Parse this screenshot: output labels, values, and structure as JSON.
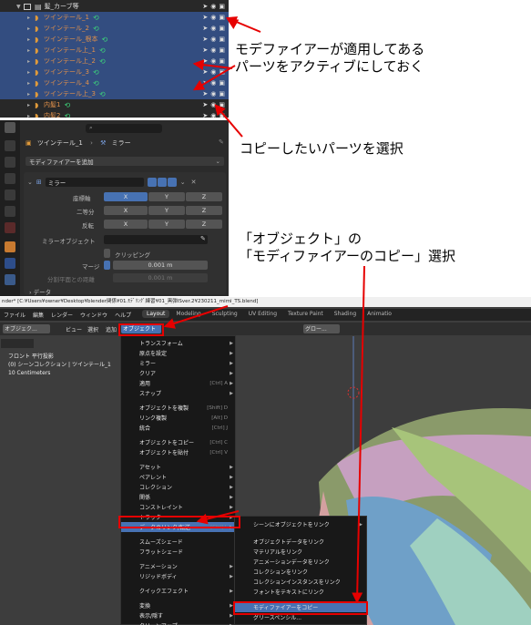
{
  "annotations": {
    "a1_line1": "モデファイアーが適用してある",
    "a1_line2": "パーツをアクティブにしておく",
    "a2": "コピーしたいパーツを選択",
    "a3_line1": "「オブジェクト」の",
    "a3_line2": "「モディファイアーのコピー」選択"
  },
  "outliner": {
    "parent": "髪_カーブ等",
    "items": [
      {
        "name": "ツインテール_1",
        "selected": true
      },
      {
        "name": "ツインテール_2",
        "selected": true
      },
      {
        "name": "ツインテール_根本",
        "selected": true
      },
      {
        "name": "ツインテール上_1",
        "selected": true
      },
      {
        "name": "ツインテール上_2",
        "selected": true
      },
      {
        "name": "ツインテール_3",
        "selected": true
      },
      {
        "name": "ツインテール_4",
        "selected": true
      },
      {
        "name": "ツインテール上_3",
        "selected": true
      },
      {
        "name": "内髪1",
        "selected": false
      },
      {
        "name": "内髪2",
        "selected": false
      }
    ]
  },
  "props": {
    "breadcrumb_obj": "ツインテール_1",
    "breadcrumb_mod": "ミラー",
    "add_modifier": "モディファイアーを追加",
    "modifier_name": "ミラー",
    "axis_label": "座標軸",
    "bisect_label": "二等分",
    "flip_label": "反転",
    "x": "X",
    "y": "Y",
    "z": "Z",
    "mirror_object_label": "ミラーオブジェクト",
    "clipping": "クリッピング",
    "merge_label": "マージ",
    "merge_value": "0.001 m",
    "bisect_dist_label": "分割平面との距離",
    "bisect_dist_value": "0.001 m",
    "data_label": "データ"
  },
  "window": {
    "titlebar": "nder* [C:¥Users¥owner¥Desktop¥blender関係¥01.ﾓﾃﾞﾘﾝｸﾞ練習¥01_黒弾ISver.2¥230211_mimi_TS.blend]",
    "menubar": [
      "ファイル",
      "編集",
      "レンダー",
      "ウィンドウ",
      "ヘルプ"
    ],
    "workspaces": [
      "Layout",
      "Modeling",
      "Sculpting",
      "UV Editing",
      "Texture Paint",
      "Shading",
      "Animatio"
    ],
    "header": {
      "mode": "オブジェク...",
      "view": "ビュー",
      "select": "選択",
      "add": "追加",
      "object": "オブジェクト",
      "transform": "グロー..."
    },
    "viewport_info": [
      "フロント 平行投影",
      "(0) シーンコレクション | ツインテール_1",
      "10 Centimeters"
    ]
  },
  "object_menu": [
    {
      "label": "トランスフォーム",
      "sc": "",
      "sub": true
    },
    {
      "label": "原点を設定",
      "sc": "",
      "sub": true
    },
    {
      "label": "ミラー",
      "sc": "",
      "sub": true
    },
    {
      "label": "クリア",
      "sc": "",
      "sub": true
    },
    {
      "label": "適用",
      "sc": "[Ctrl] A",
      "sub": true
    },
    {
      "label": "スナップ",
      "sc": "",
      "sub": true
    },
    {
      "label": "オブジェクトを複製",
      "sc": "[Shift] D",
      "sub": false
    },
    {
      "label": "リンク複製",
      "sc": "[Alt] D",
      "sub": false
    },
    {
      "label": "統合",
      "sc": "[Ctrl] J",
      "sub": false
    },
    {
      "label": "オブジェクトをコピー",
      "sc": "[Ctrl] C",
      "sub": false
    },
    {
      "label": "オブジェクトを貼付",
      "sc": "[Ctrl] V",
      "sub": false
    },
    {
      "label": "アセット",
      "sc": "",
      "sub": true
    },
    {
      "label": "ペアレント",
      "sc": "",
      "sub": true
    },
    {
      "label": "コレクション",
      "sc": "",
      "sub": true
    },
    {
      "label": "関係",
      "sc": "",
      "sub": true
    },
    {
      "label": "コンストレイント",
      "sc": "",
      "sub": true
    },
    {
      "label": "トラック",
      "sc": "",
      "sub": true
    },
    {
      "label": "データのリンク/転送",
      "sc": "[Ctrl] L",
      "sub": true
    },
    {
      "label": "スムーズシェード",
      "sc": "",
      "sub": false
    },
    {
      "label": "フラットシェード",
      "sc": "",
      "sub": false
    },
    {
      "label": "アニメーション",
      "sc": "",
      "sub": true
    },
    {
      "label": "リジッドボディ",
      "sc": "",
      "sub": true
    },
    {
      "label": "クイックエフェクト",
      "sc": "",
      "sub": true
    },
    {
      "label": "変換",
      "sc": "",
      "sub": true
    },
    {
      "label": "表示/隠す",
      "sc": "",
      "sub": true
    },
    {
      "label": "クリーンアップ",
      "sc": "",
      "sub": true
    }
  ],
  "link_submenu": [
    "シーンにオブジェクトをリンク",
    "オブジェクトデータをリンク",
    "マテリアルをリンク",
    "アニメーションデータをリンク",
    "コレクションをリンク",
    "コレクションインスタンスをリンク",
    "フォントをテキストにリンク",
    "モディファイアーをコピー",
    "グリースペンシル..."
  ],
  "colors": {
    "annotation_red": "#e60000",
    "selected_blue": "#4772b3",
    "modifier_green": "#3dd67a"
  }
}
